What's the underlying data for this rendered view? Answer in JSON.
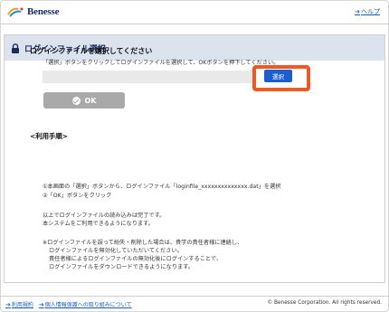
{
  "header": {
    "brand": "Benesse",
    "help_label": "ヘルプ"
  },
  "panel": {
    "title": "ログインファイル選択",
    "section_title": "ログインファイルを選択してください",
    "instruction": "「選択」ボタンをクリックしてログインファイルを選択して、OKボタンを押下してください。",
    "select_label": "選択",
    "ok_label": "OK",
    "procedure_title": "<利用手順>",
    "steps": [
      "①本画面の「選択」ボタンから、ログインファイル「loginfile_xxxxxxxxxxxxxx.dat」を選択",
      "②「OK」ボタンをクリック"
    ],
    "done_lines": [
      "以上でログインファイルの読み込みは完了です。",
      "本システムをご利用できるようになります。"
    ],
    "notes": [
      "※ログインファイルを誤って紛失・削除した場合は、貴学の責任者様に連絡し、",
      "ログインファイルを無効化していただいてください。",
      "責任者様によるログインファイルの無効化後にログインすることで、",
      "ログインファイルをダウンロードできるようになります。"
    ]
  },
  "footer": {
    "links": [
      "利用規約",
      "個人情報保護への取り組みについて"
    ],
    "copyright": "© Benesse Corporation. All rights reserved."
  },
  "colors": {
    "brand_navy": "#1b2a5a",
    "link_blue": "#1a5fb4",
    "button_blue": "#1a5fd0",
    "highlight_orange": "#f05a22",
    "title_bar": "#dde3ee"
  }
}
